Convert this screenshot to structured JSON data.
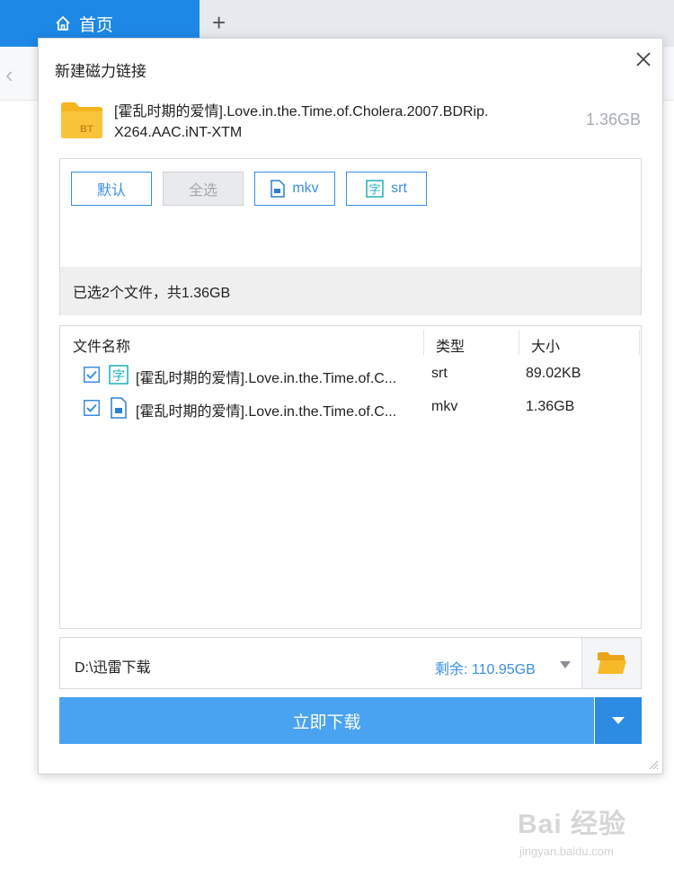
{
  "app": {
    "home_tab_label": "首页",
    "new_tab_symbol": "+",
    "back_symbol": "‹"
  },
  "dialog": {
    "title": "新建磁力链接",
    "torrent": {
      "badge": "BT",
      "name": "[霍乱时期的爱情].Love.in.the.Time.of.Cholera.2007.BDRip.X264.AAC.iNT-XTM",
      "size": "1.36GB"
    },
    "filters": {
      "default_label": "默认",
      "select_all_label": "全选",
      "mkv_label": "mkv",
      "srt_label": "srt",
      "mkv_icon": "document-icon",
      "srt_icon": "subtitle-icon"
    },
    "summary": "已选2个文件，共1.36GB",
    "file_list": {
      "columns": [
        "文件名称",
        "类型",
        "大小"
      ],
      "rows": [
        {
          "checked": true,
          "icon": "subtitle-icon",
          "name": "[霍乱时期的爱情].Love.in.the.Time.of.C...",
          "type": "srt",
          "size": "89.02KB"
        },
        {
          "checked": true,
          "icon": "document-icon",
          "name": "[霍乱时期的爱情].Love.in.the.Time.of.C...",
          "type": "mkv",
          "size": "1.36GB"
        }
      ]
    },
    "path": "D:\\迅雷下载",
    "free_space": "剩余: 110.95GB",
    "download_label": "立即下载"
  },
  "watermark": {
    "logo": "Bai 经验",
    "url": "jingyan.baidu.com"
  },
  "colors": {
    "accent": "#1e88e5",
    "button_blue": "#4aa3f0",
    "link_blue": "#3a8ee6",
    "folder_yellow": "#f5b51f"
  }
}
